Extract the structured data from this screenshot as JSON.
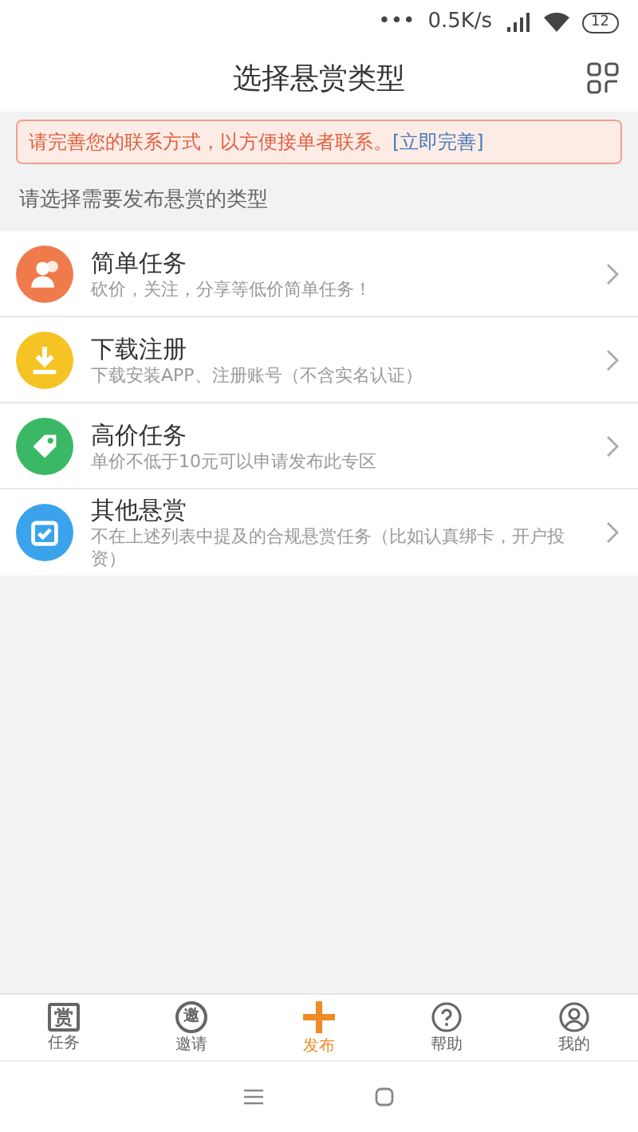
{
  "status_bar": {
    "dots": "•••",
    "speed": "0.5K/s",
    "battery": "12"
  },
  "header": {
    "title": "选择悬赏类型"
  },
  "notice": {
    "text": "请完善您的联系方式，以方便接单者联系。",
    "link": "[立即完善]"
  },
  "hint": "请选择需要发布悬赏的类型",
  "types": [
    {
      "kind": "people",
      "color": "#ef7b4d",
      "title": "简单任务",
      "desc": "砍价，关注，分享等低价简单任务！"
    },
    {
      "kind": "download",
      "color": "#f6c325",
      "title": "下载注册",
      "desc": "下载安装APP、注册账号（不含实名认证）"
    },
    {
      "kind": "tag",
      "color": "#3bb866",
      "title": "高价任务",
      "desc": "单价不低于10元可以申请发布此专区"
    },
    {
      "kind": "calendar",
      "color": "#3aa3ec",
      "title": "其他悬赏",
      "desc": "不在上述列表中提及的合规悬赏任务（比如认真绑卡，开户投资）"
    }
  ],
  "tabs": [
    {
      "kind": "char",
      "icon_text": "赏",
      "label": "任务",
      "selected": false
    },
    {
      "kind": "circlechar",
      "icon_text": "邀",
      "label": "邀请",
      "selected": false
    },
    {
      "kind": "plus",
      "label": "发布",
      "selected": true
    },
    {
      "kind": "help",
      "label": "帮助",
      "selected": false
    },
    {
      "kind": "user",
      "label": "我的",
      "selected": false
    }
  ]
}
